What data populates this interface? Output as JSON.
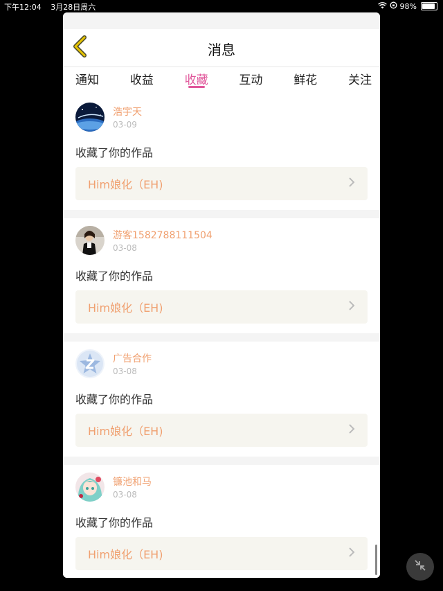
{
  "statusbar": {
    "time": "下午12:04",
    "date": "3月28日周六",
    "battery": "98%"
  },
  "header": {
    "title": "消息"
  },
  "tabs": [
    "通知",
    "收益",
    "收藏",
    "互动",
    "鲜花",
    "关注"
  ],
  "active_tab": "收藏",
  "items": [
    {
      "user": "浩宇天",
      "date": "03-09",
      "action": "收藏了你的作品",
      "work": "Him娘化（EH)",
      "avatar": "space-planet"
    },
    {
      "user": "游客1582788111504",
      "date": "03-08",
      "action": "收藏了你的作品",
      "work": "Him娘化（EH)",
      "avatar": "person-photo"
    },
    {
      "user": "广告合作",
      "date": "03-08",
      "action": "收藏了你的作品",
      "work": "Him娘化（EH)",
      "avatar": "z-logo"
    },
    {
      "user": "镰池和马",
      "date": "03-08",
      "action": "收藏了你的作品",
      "work": "Him娘化（EH)",
      "avatar": "anime-girl"
    }
  ],
  "colors": {
    "accent": "#e0569a",
    "username": "#f0a070",
    "back_icon": "#e8c400"
  }
}
